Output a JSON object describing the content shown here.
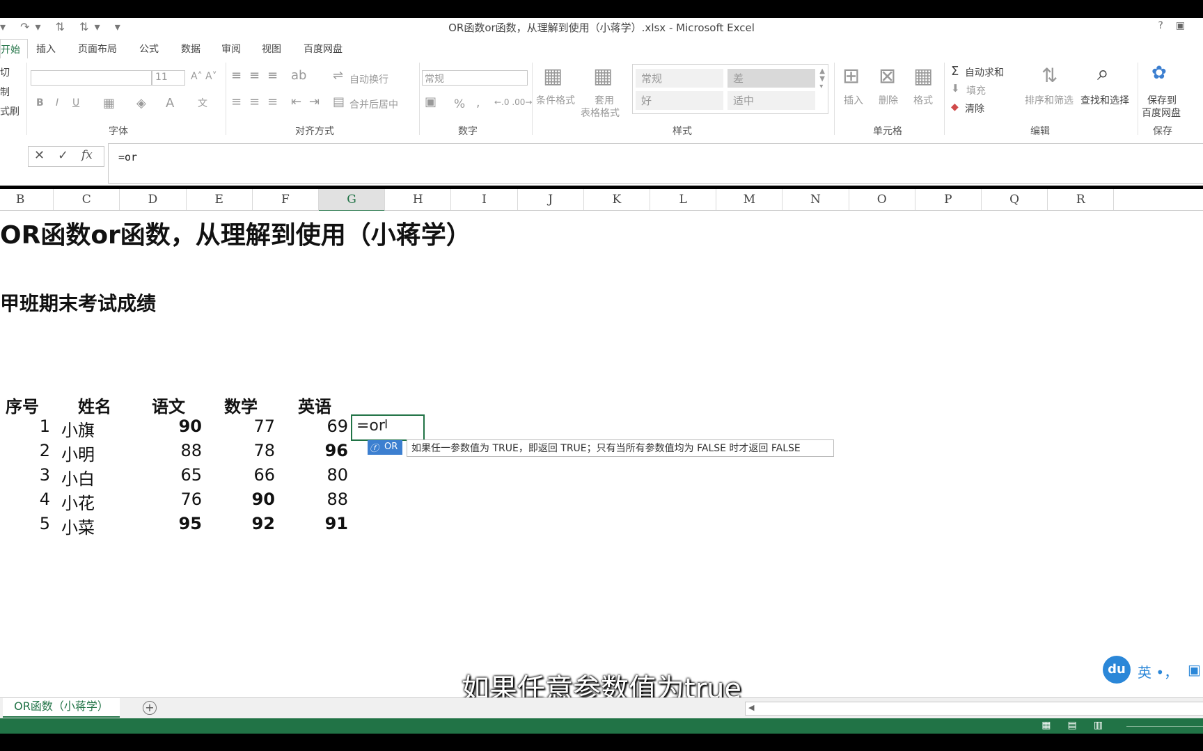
{
  "window": {
    "title": "OR函数or函数，从理解到使用（小蒋学）.xlsx - Microsoft Excel",
    "help_label": "?"
  },
  "tabs": [
    {
      "label": "开始",
      "active": true
    },
    {
      "label": "插入"
    },
    {
      "label": "页面布局"
    },
    {
      "label": "公式"
    },
    {
      "label": "数据"
    },
    {
      "label": "审阅"
    },
    {
      "label": "视图"
    },
    {
      "label": "百度网盘"
    }
  ],
  "ribbon": {
    "clipboard": {
      "cut": "切",
      "copy": "制",
      "format_painter": "式刷"
    },
    "font": {
      "group_label": "字体",
      "size": "11",
      "bold": "B",
      "italic": "I",
      "underline": "U"
    },
    "alignment": {
      "group_label": "对齐方式",
      "wrap_text": "自动换行",
      "merge_center": "合并后居中"
    },
    "number": {
      "group_label": "数字",
      "format": "常规",
      "percent": "%",
      "comma": ","
    },
    "styles": {
      "group_label": "样式",
      "conditional_format": "条件格式",
      "table_format_1": "套用",
      "table_format_2": "表格格式",
      "normal": "常规",
      "bad": "差",
      "good": "好",
      "neutral": "适中"
    },
    "cells": {
      "group_label": "单元格",
      "insert": "插入",
      "delete": "删除",
      "format": "格式"
    },
    "editing": {
      "group_label": "编辑",
      "autosum": "自动求和",
      "fill": "填充",
      "clear": "清除",
      "sort_filter": "排序和筛选",
      "find_select": "查找和选择"
    },
    "save": {
      "group_label": "保存",
      "save_to_1": "保存到",
      "save_to_2": "百度网盘"
    }
  },
  "formula_bar": {
    "content": "=or",
    "fx": "fx"
  },
  "columns": [
    "B",
    "C",
    "D",
    "E",
    "F",
    "G",
    "H",
    "I",
    "J",
    "K",
    "L",
    "M",
    "N",
    "O",
    "P",
    "Q",
    "R"
  ],
  "selected_column": "G",
  "sheet": {
    "title": "OR函数or函数，从理解到使用（小蒋学）",
    "subtitle": "甲班期末考试成绩",
    "headers": [
      "序号",
      "姓名",
      "语文",
      "数学",
      "英语"
    ],
    "rows": [
      {
        "no": "1",
        "name": "小旗",
        "chinese": "90",
        "math": "77",
        "english": "69",
        "bold": [
          true,
          false,
          false
        ]
      },
      {
        "no": "2",
        "name": "小明",
        "chinese": "88",
        "math": "78",
        "english": "96",
        "bold": [
          false,
          false,
          true
        ]
      },
      {
        "no": "3",
        "name": "小白",
        "chinese": "65",
        "math": "66",
        "english": "80",
        "bold": [
          false,
          false,
          false
        ]
      },
      {
        "no": "4",
        "name": "小花",
        "chinese": "76",
        "math": "90",
        "english": "88",
        "bold": [
          false,
          true,
          false
        ]
      },
      {
        "no": "5",
        "name": "小菜",
        "chinese": "95",
        "math": "92",
        "english": "91",
        "bold": [
          true,
          true,
          true
        ]
      }
    ],
    "edit_cell_value": "=or"
  },
  "autocomplete": {
    "function_name": "OR",
    "description": "如果任一参数值为 TRUE，即返回 TRUE；只有当所有参数值均为 FALSE 时才返回 FALSE"
  },
  "video_subtitle": "如果任意参数值为true",
  "ime": {
    "logo": "du",
    "mode": "英 •，"
  },
  "sheet_tabs": [
    {
      "label": "OR函数（小蒋学）",
      "active": true
    }
  ],
  "add_sheet": "+",
  "colors": {
    "accent": "#217346",
    "tooltip_icon": "#3c7fd0"
  }
}
